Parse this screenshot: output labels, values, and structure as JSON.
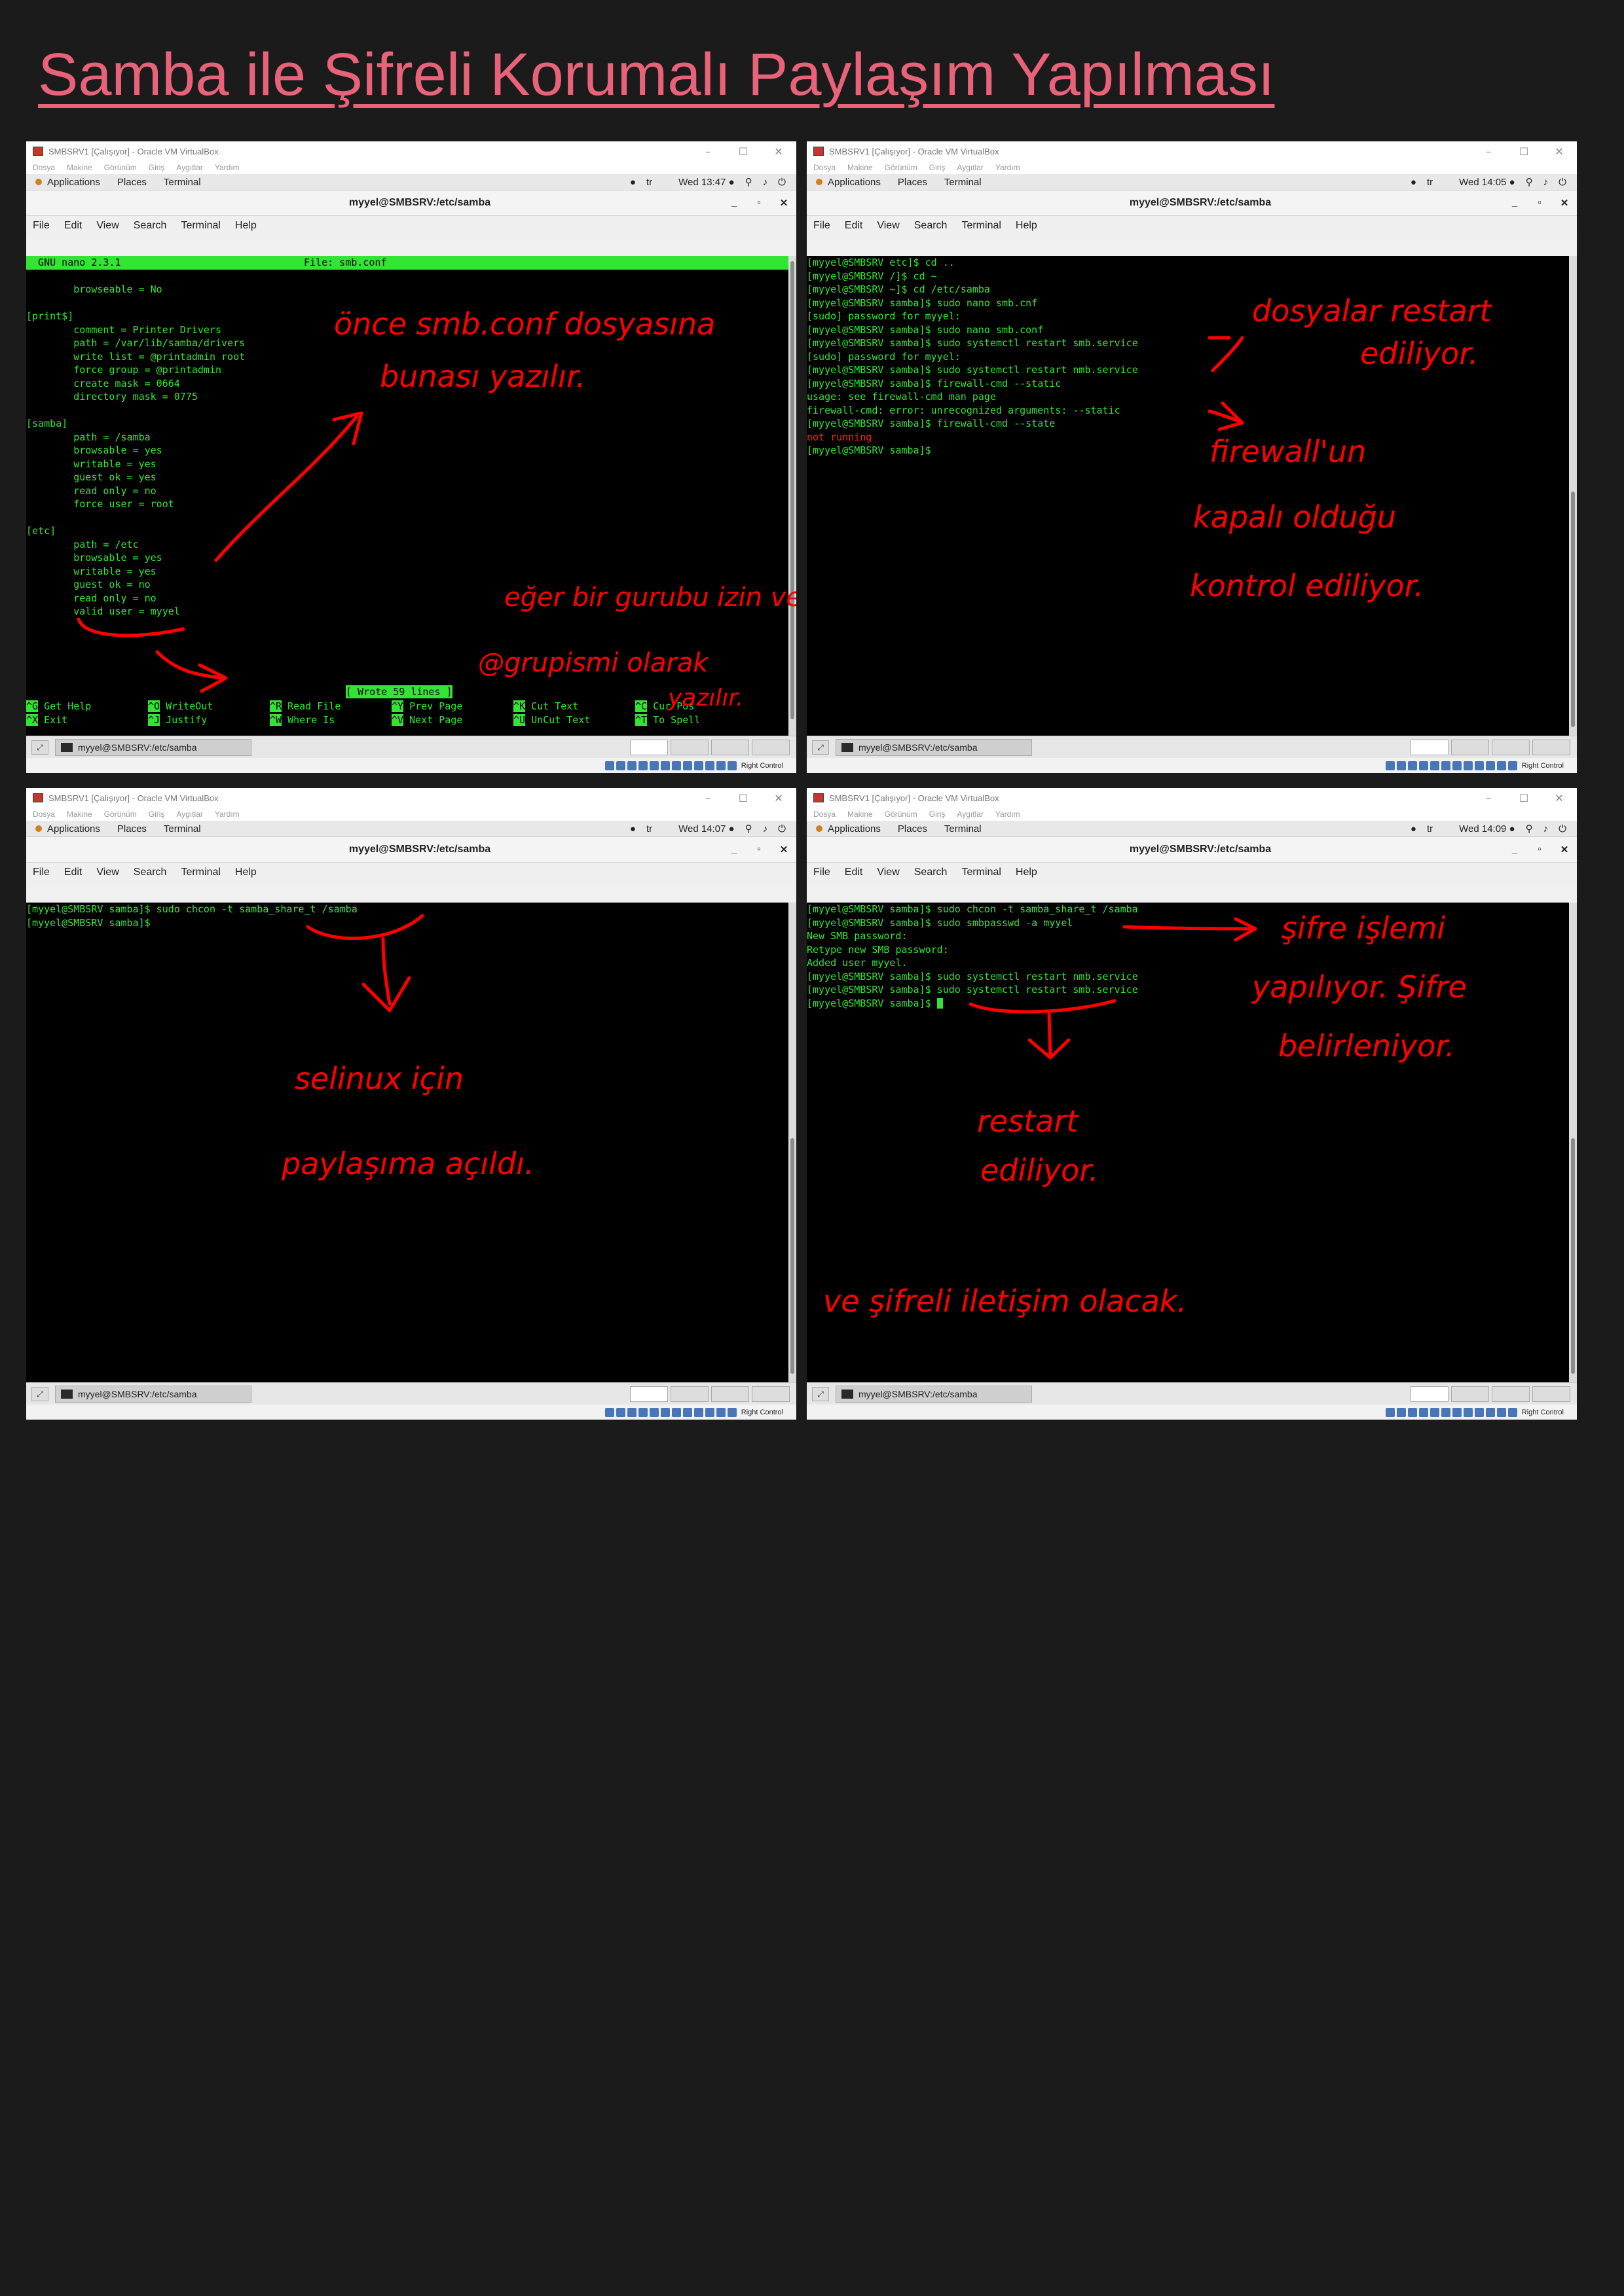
{
  "page": {
    "title": "Samba ile Şifreli Korumalı Paylaşım Yapılması"
  },
  "vm_common": {
    "window_title": "SMBSRV1 [Çalışıyor] - Oracle VM VirtualBox",
    "vbox_menu": [
      "Dosya",
      "Makine",
      "Görünüm",
      "Giriş",
      "Aygıtlar",
      "Yardım"
    ],
    "applications": "Applications",
    "places": "Places",
    "terminal": "Terminal",
    "lang": "tr",
    "terminal_title": "myyel@SMBSRV:/etc/samba",
    "terminal_menu": [
      "File",
      "Edit",
      "View",
      "Search",
      "Terminal",
      "Help"
    ],
    "taskbar_item": "myyel@SMBSRV:/etc/samba",
    "right_control": "Right Control"
  },
  "screens": [
    {
      "clock": "Wed 13:47 ●",
      "nano": {
        "header_left": "  GNU nano 2.3.1",
        "header_right": "File: smb.conf",
        "lines": [
          "",
          "        browseable = No",
          "",
          "[print$]",
          "        comment = Printer Drivers",
          "        path = /var/lib/samba/drivers",
          "        write list = @printadmin root",
          "        force group = @printadmin",
          "        create mask = 0664",
          "        directory mask = 0775",
          "",
          "[samba]",
          "        path = /samba",
          "        browsable = yes",
          "        writable = yes",
          "        guest ok = yes",
          "        read only = no",
          "        force user = root",
          "",
          "[etc]",
          "        path = /etc",
          "        browsable = yes",
          "        writable = yes",
          "        guest ok = no",
          "        read only = no",
          "        valid user = myyel"
        ],
        "status": "[ Wrote 59 lines ]",
        "help_row1": [
          {
            "key": "^G",
            "label": "Get Help"
          },
          {
            "key": "^O",
            "label": "WriteOut"
          },
          {
            "key": "^R",
            "label": "Read File"
          },
          {
            "key": "^Y",
            "label": "Prev Page"
          },
          {
            "key": "^K",
            "label": "Cut Text"
          },
          {
            "key": "^C",
            "label": "Cur Pos"
          }
        ],
        "help_row2": [
          {
            "key": "^X",
            "label": "Exit"
          },
          {
            "key": "^J",
            "label": "Justify"
          },
          {
            "key": "^W",
            "label": "Where Is"
          },
          {
            "key": "^V",
            "label": "Next Page"
          },
          {
            "key": "^U",
            "label": "UnCut Text"
          },
          {
            "key": "^T",
            "label": "To Spell"
          }
        ]
      },
      "annotations": [
        "önce smb.conf dosyasına",
        "bunası yazılır.",
        "eğer bir gurubu izin verilecekse",
        "@grupismi olarak",
        "yazılır."
      ]
    },
    {
      "clock": "Wed 14:05 ●",
      "lines": [
        "[myyel@SMBSRV etc]$ cd ..",
        "[myyel@SMBSRV /]$ cd ~",
        "[myyel@SMBSRV ~]$ cd /etc/samba",
        "[myyel@SMBSRV samba]$ sudo nano smb.cnf",
        "[sudo] password for myyel:",
        "[myyel@SMBSRV samba]$ sudo nano smb.conf",
        "[myyel@SMBSRV samba]$ sudo systemctl restart smb.service",
        "[sudo] password for myyel:",
        "[myyel@SMBSRV samba]$ sudo systemctl restart nmb.service",
        "[myyel@SMBSRV samba]$ firewall-cmd --static",
        "usage: see firewall-cmd man page",
        "firewall-cmd: error: unrecognized arguments: --static",
        "[myyel@SMBSRV samba]$ firewall-cmd --state"
      ],
      "error_line": "not running",
      "last_line": "[myyel@SMBSRV samba]$",
      "annotations": [
        "dosyalar restart",
        "ediliyor.",
        "firewall'un",
        "kapalı olduğu",
        "kontrol ediliyor."
      ]
    },
    {
      "clock": "Wed 14:07 ●",
      "lines": [
        "[myyel@SMBSRV samba]$ sudo chcon -t samba_share_t /samba",
        "[myyel@SMBSRV samba]$"
      ],
      "annotations": [
        "selinux için",
        "paylaşıma açıldı."
      ]
    },
    {
      "clock": "Wed 14:09 ●",
      "lines": [
        "[myyel@SMBSRV samba]$ sudo chcon -t samba_share_t /samba",
        "[myyel@SMBSRV samba]$ sudo smbpasswd -a myyel",
        "New SMB password:",
        "Retype new SMB password:",
        "Added user myyel.",
        "[myyel@SMBSRV samba]$ sudo systemctl restart nmb.service",
        "[myyel@SMBSRV samba]$ sudo systemctl restart smb.service"
      ],
      "last_line": "[myyel@SMBSRV samba]$ ",
      "annotations": [
        "şifre işlemi",
        "yapılıyor. Şifre",
        "belirleniyor.",
        "restart",
        "ediliyor.",
        "ve şifreli iletişim olacak."
      ]
    }
  ]
}
